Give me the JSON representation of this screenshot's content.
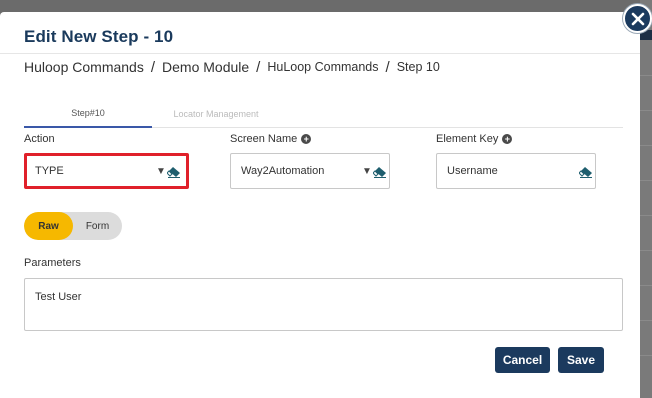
{
  "modal": {
    "title": "Edit New Step - 10"
  },
  "breadcrumb": [
    {
      "label": "Huloop Commands"
    },
    {
      "label": "Demo Module"
    },
    {
      "label": "HuLoop Commands"
    },
    {
      "label": "Step 10"
    }
  ],
  "breadcrumb_separator": "/",
  "tabs": [
    {
      "label": "Step#10",
      "active": true
    },
    {
      "label": "Locator Management",
      "active": false
    }
  ],
  "fields": {
    "action": {
      "label": "Action",
      "value": "TYPE"
    },
    "screen_name": {
      "label": "Screen Name",
      "value": "Way2Automation"
    },
    "element_key": {
      "label": "Element Key",
      "value": "Username"
    }
  },
  "mode_toggle": {
    "options": [
      "Raw",
      "Form"
    ],
    "selected": "Raw"
  },
  "parameters": {
    "label": "Parameters",
    "value": "Test User"
  },
  "buttons": {
    "cancel": "Cancel",
    "save": "Save"
  },
  "colors": {
    "primary": "#1b3a5e",
    "accent_yellow": "#f6b800",
    "highlight_red": "#e0202a",
    "tab_underline": "#3a58a8",
    "eraser_teal": "#1e5e6e"
  },
  "icons": {
    "close": "close-icon",
    "add": "plus-circle-icon",
    "clear": "eraser-icon",
    "dropdown": "caret-down-icon"
  }
}
